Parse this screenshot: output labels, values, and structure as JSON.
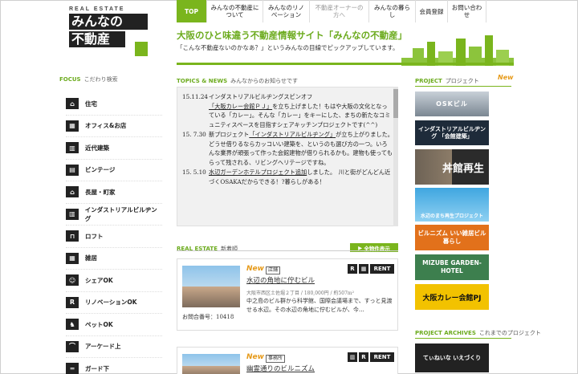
{
  "logo": {
    "label": "REAL ESTATE",
    "line1": "みんなの",
    "line2": "不動産"
  },
  "nav": [
    {
      "label": "TOP"
    },
    {
      "label": "みんなの不動産について"
    },
    {
      "label": "みんなのリノベーション"
    },
    {
      "label": "不動産オーナーの方へ"
    },
    {
      "label": "みんなの暮らし"
    },
    {
      "label": "会員登録"
    },
    {
      "label": "お問い合わせ"
    }
  ],
  "hero": {
    "title": "大阪のひと味違う不動産情報サイト「みんなの不動産」",
    "subtitle": "「こんな不動産ないのかなあ？」というみんなの目線でピックアップしています。"
  },
  "focus": {
    "title": "FOCUS",
    "subtitle": "こだわり検索"
  },
  "categories": [
    "住宅",
    "オフィス&お店",
    "近代建築",
    "ビンテージ",
    "長屋・町家",
    "インダストリアルビルヂング",
    "ロフト",
    "雑居",
    "シェアOK",
    "リノベーションOK",
    "ペットOK",
    "アーケード上",
    "ガード下"
  ],
  "topics": {
    "title": "TOPICS & NEWS",
    "subtitle": "みんなからのお知らせです",
    "items": [
      {
        "date": "15.11.24",
        "pre": "インダストリアルビルヂングスピンオフ",
        "link": "「大阪カレー会館ＰＪ」",
        "post": "を立ち上げました！もはや大阪の文化となっている「カレー」。そんな「カレー」をキーにした、まちの新たなコミュニティスペースを目指すシェアキッチンプロジェクトです(^^)"
      },
      {
        "date": "15. 7.30",
        "pre": "新プロジェクト",
        "link": "「インダストリアルビルヂング」",
        "post": "が立ち上がりました。　どうせ借りるならカッコいい建築を、というのも選び方の一つ。いろんな業界が頑張って作った会館建物が借りられるかも。建物も使ってもらって残される、リビングヘリテージですね。"
      },
      {
        "date": "15. 5.10",
        "pre": "",
        "link": "水辺ガーデンホテルプロジェクト追加",
        "post": "しました。　川と街がどんどん近づくOSAKAだからできる！?暮らしがある！"
      }
    ]
  },
  "real_estate": {
    "title": "REAL ESTATE",
    "subtitle": "新着順",
    "all_button": "全物件表示",
    "cards": [
      {
        "new": "New",
        "tag": "店舗",
        "title": "水辺の角地に佇むビル",
        "address": "大阪市西区土佐堀２丁目 / 180,000円 / 約507m²",
        "desc": "中之島のビル群から科学館、国際会議場まで、すっと見渡せる水辺。その水辺の角地に佇むビルが、今…",
        "inquiry": "お問合番号：10418",
        "badge": "RENT"
      },
      {
        "new": "New",
        "tag": "事務所",
        "title": "幽霊通りのビルニズム",
        "badge": "RENT"
      }
    ]
  },
  "project": {
    "title": "PROJECT",
    "subtitle": "プロジェクト",
    "new": "New",
    "banners": [
      "OSKビル",
      "インダストリアルビルヂング 「会館建築」",
      "丼館再生",
      "水辺のまち再生プロジェクト",
      "ビルニズム いい雑居ビル暮らし",
      "MIZUBE GARDEN-HOTEL",
      "大阪カレー会館PJ",
      "てぃねいな いえづくり"
    ]
  },
  "archives": {
    "title": "PROJECT ARCHIVES",
    "subtitle": "これまでのプロジェクト"
  }
}
